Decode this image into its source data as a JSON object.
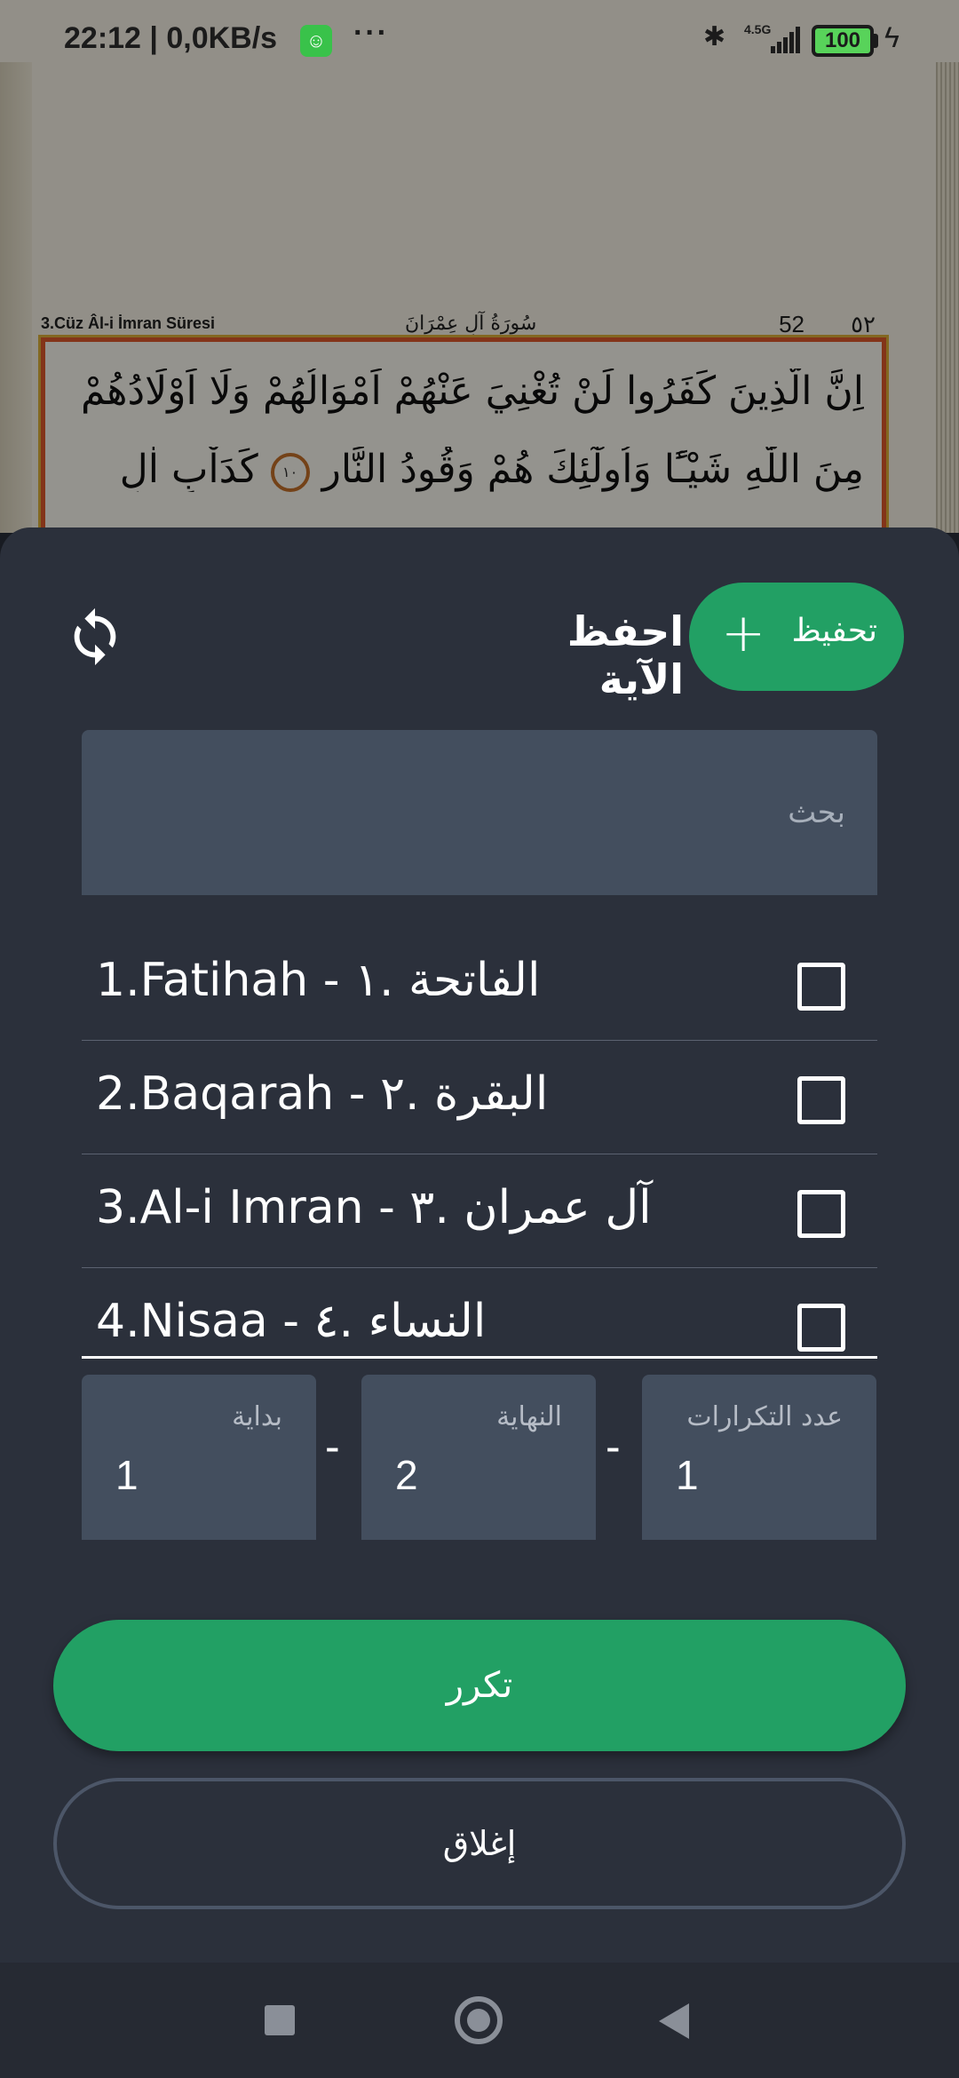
{
  "status_bar": {
    "time_speed": "22:12 | 0,0KB/s",
    "app_icon": "android-face-icon",
    "more": "···",
    "network_type": "4.5G",
    "battery": "100"
  },
  "background_page": {
    "juz_label": "3.Cüz Âl-i İmran Süresi",
    "surah_header": "سُورَةُ آلِ عِمْرَانَ",
    "page_number": "52",
    "page_number_ar": "٥٢",
    "verse_line_1": "اِنَّ الَّذِينَ كَفَرُوا لَنْ تُغْنِيَ عَنْهُمْ اَمْوَالُهُمْ وَلَا اَوْلَادُهُمْ",
    "verse_line_2": "مِنَ اللّٰهِ شَيْـًٔا وَاُولٰٓئِكَ هُمْ وَقُودُ النَّارِ",
    "verse_line_2_end": "كَدَاْبِ اٰلِ",
    "ayah_number": "١٠"
  },
  "sheet": {
    "title": "احفظ الآية",
    "memorize_button": "تحفيظ",
    "search_placeholder": "بحث",
    "surahs": [
      {
        "label": "1.Fatihah - الفاتحة .١",
        "checked": false
      },
      {
        "label": "2.Baqarah - البقرة .٢",
        "checked": false
      },
      {
        "label": "3.Al-i Imran - آل عمران .٣",
        "checked": false
      },
      {
        "label": "4.Nisaa - النساء .٤",
        "checked": false
      }
    ],
    "start_label": "بداية",
    "start_value": "1",
    "end_label": "النهاية",
    "end_value": "2",
    "count_label": "عدد التكرارات",
    "count_value": "1",
    "separator": "-",
    "repeat_button": "تكرر",
    "close_button": "إغلاق"
  },
  "colors": {
    "accent_green": "#22a064",
    "sheet_bg": "#2b303b",
    "field_bg": "#434e5e"
  }
}
